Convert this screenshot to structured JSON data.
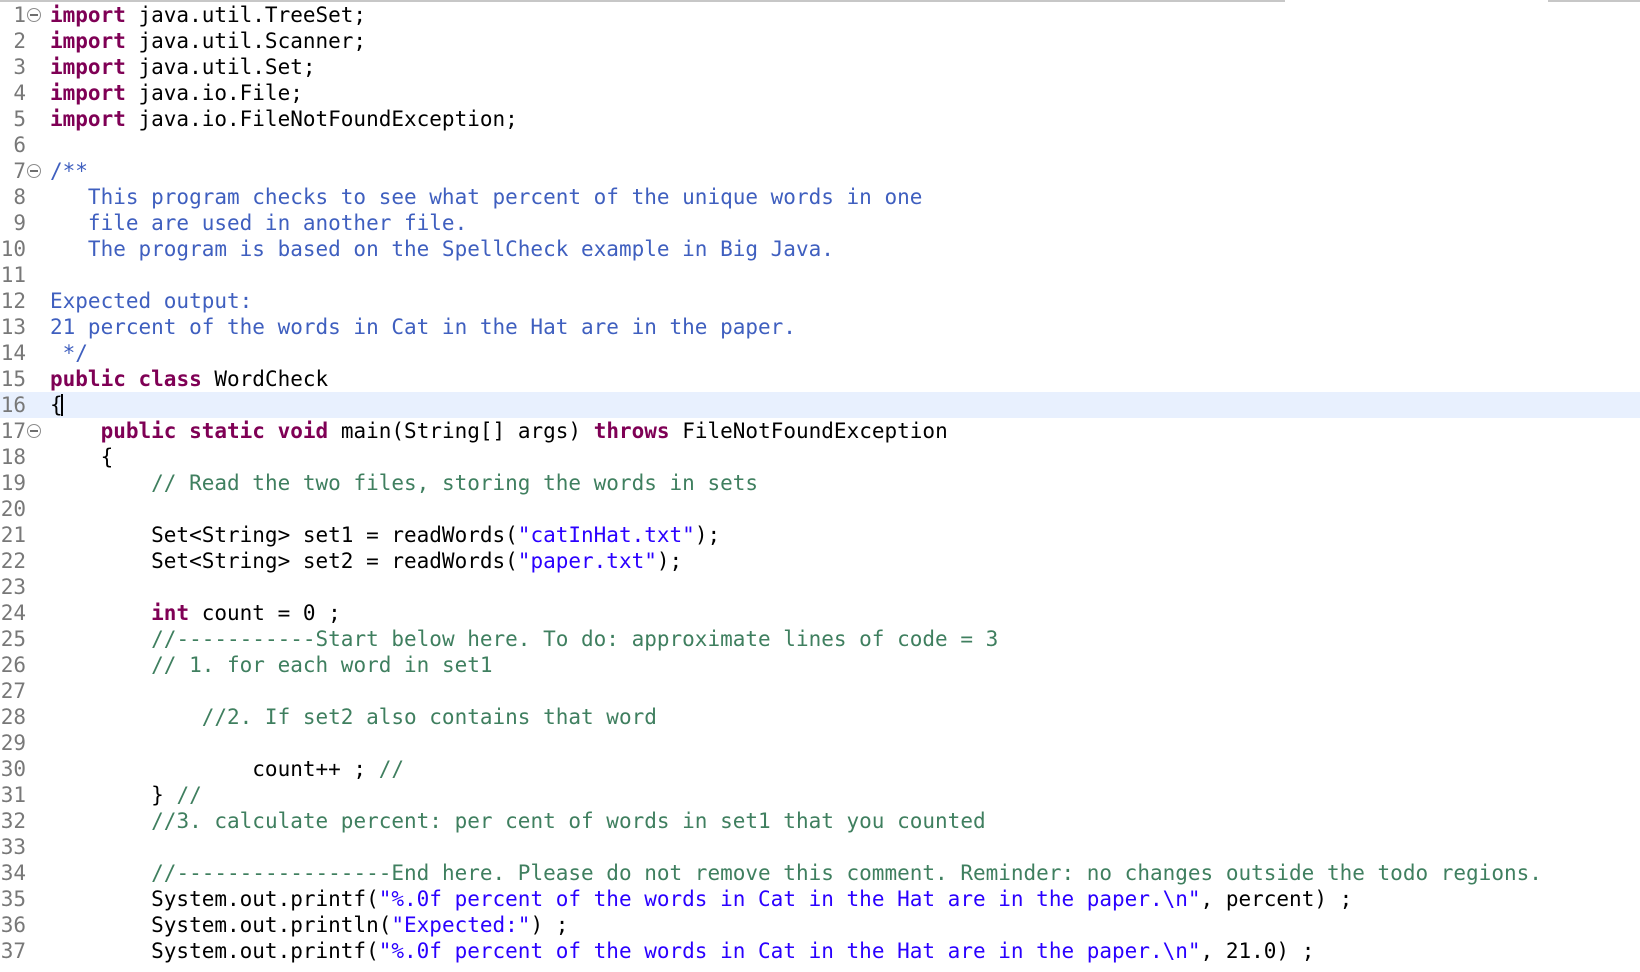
{
  "editor": {
    "language": "java",
    "current_line": 16,
    "colors": {
      "keyword": "#7f0055",
      "javadoc": "#3f5fbf",
      "comment": "#3f7f5f",
      "string": "#2a00ff",
      "plain": "#000000",
      "line_number": "#787878",
      "current_line_bg": "#e8f0fe"
    },
    "lines": [
      {
        "n": "1",
        "fold": true,
        "tokens": [
          {
            "t": "kw",
            "v": "import"
          },
          {
            "t": "pl",
            "v": " java.util.TreeSet;"
          }
        ]
      },
      {
        "n": "2",
        "tokens": [
          {
            "t": "kw",
            "v": "import"
          },
          {
            "t": "pl",
            "v": " java.util.Scanner;"
          }
        ]
      },
      {
        "n": "3",
        "tokens": [
          {
            "t": "kw",
            "v": "import"
          },
          {
            "t": "pl",
            "v": " java.util.Set;"
          }
        ]
      },
      {
        "n": "4",
        "tokens": [
          {
            "t": "kw",
            "v": "import"
          },
          {
            "t": "pl",
            "v": " java.io.File;"
          }
        ]
      },
      {
        "n": "5",
        "tokens": [
          {
            "t": "kw",
            "v": "import"
          },
          {
            "t": "pl",
            "v": " java.io.FileNotFoundException;"
          }
        ]
      },
      {
        "n": "6",
        "tokens": []
      },
      {
        "n": "7",
        "fold": true,
        "tokens": [
          {
            "t": "jd",
            "v": "/**"
          }
        ]
      },
      {
        "n": "8",
        "tokens": [
          {
            "t": "jd",
            "v": "   This program checks to see what percent of the unique words in one"
          }
        ]
      },
      {
        "n": "9",
        "tokens": [
          {
            "t": "jd",
            "v": "   file are used in another file."
          }
        ]
      },
      {
        "n": "10",
        "tokens": [
          {
            "t": "jd",
            "v": "   The program is based on the SpellCheck example in Big Java."
          }
        ]
      },
      {
        "n": "11",
        "tokens": []
      },
      {
        "n": "12",
        "tokens": [
          {
            "t": "jd",
            "v": "Expected output:"
          }
        ]
      },
      {
        "n": "13",
        "tokens": [
          {
            "t": "jd",
            "v": "21 percent of the words in Cat in the Hat are in the paper."
          }
        ]
      },
      {
        "n": "14",
        "tokens": [
          {
            "t": "jd",
            "v": " */"
          }
        ]
      },
      {
        "n": "15",
        "tokens": [
          {
            "t": "kw",
            "v": "public"
          },
          {
            "t": "pl",
            "v": " "
          },
          {
            "t": "kw",
            "v": "class"
          },
          {
            "t": "pl",
            "v": " WordCheck"
          }
        ]
      },
      {
        "n": "16",
        "caret": true,
        "tokens": [
          {
            "t": "pl",
            "v": "{"
          }
        ]
      },
      {
        "n": "17",
        "fold": true,
        "tokens": [
          {
            "t": "pl",
            "v": "    "
          },
          {
            "t": "kw",
            "v": "public"
          },
          {
            "t": "pl",
            "v": " "
          },
          {
            "t": "kw",
            "v": "static"
          },
          {
            "t": "pl",
            "v": " "
          },
          {
            "t": "kw",
            "v": "void"
          },
          {
            "t": "pl",
            "v": " main(String[] args) "
          },
          {
            "t": "kw",
            "v": "throws"
          },
          {
            "t": "pl",
            "v": " FileNotFoundException"
          }
        ]
      },
      {
        "n": "18",
        "tokens": [
          {
            "t": "pl",
            "v": "    {"
          }
        ]
      },
      {
        "n": "19",
        "tokens": [
          {
            "t": "pl",
            "v": "        "
          },
          {
            "t": "cm",
            "v": "// Read the two files, storing the words in sets"
          }
        ]
      },
      {
        "n": "20",
        "tokens": []
      },
      {
        "n": "21",
        "tokens": [
          {
            "t": "pl",
            "v": "        Set<String> set1 = readWords("
          },
          {
            "t": "st",
            "v": "\"catInHat.txt\""
          },
          {
            "t": "pl",
            "v": ");"
          }
        ]
      },
      {
        "n": "22",
        "tokens": [
          {
            "t": "pl",
            "v": "        Set<String> set2 = readWords("
          },
          {
            "t": "st",
            "v": "\"paper.txt\""
          },
          {
            "t": "pl",
            "v": ");"
          }
        ]
      },
      {
        "n": "23",
        "tokens": []
      },
      {
        "n": "24",
        "tokens": [
          {
            "t": "pl",
            "v": "        "
          },
          {
            "t": "kw",
            "v": "int"
          },
          {
            "t": "pl",
            "v": " count = 0 ;"
          }
        ]
      },
      {
        "n": "25",
        "tokens": [
          {
            "t": "pl",
            "v": "        "
          },
          {
            "t": "cm",
            "v": "//-----------Start below here. To do: approximate lines of code = 3"
          }
        ]
      },
      {
        "n": "26",
        "tokens": [
          {
            "t": "pl",
            "v": "        "
          },
          {
            "t": "cm",
            "v": "// 1. for each word in set1"
          }
        ]
      },
      {
        "n": "27",
        "tokens": []
      },
      {
        "n": "28",
        "tokens": [
          {
            "t": "pl",
            "v": "            "
          },
          {
            "t": "cm",
            "v": "//2. If set2 also contains that word"
          }
        ]
      },
      {
        "n": "29",
        "tokens": []
      },
      {
        "n": "30",
        "tokens": [
          {
            "t": "pl",
            "v": "                count++ ; "
          },
          {
            "t": "cm",
            "v": "//"
          }
        ]
      },
      {
        "n": "31",
        "tokens": [
          {
            "t": "pl",
            "v": "        } "
          },
          {
            "t": "cm",
            "v": "//"
          }
        ]
      },
      {
        "n": "32",
        "tokens": [
          {
            "t": "pl",
            "v": "        "
          },
          {
            "t": "cm",
            "v": "//3. calculate percent: per cent of words in set1 that you counted"
          }
        ]
      },
      {
        "n": "33",
        "tokens": []
      },
      {
        "n": "34",
        "tokens": [
          {
            "t": "pl",
            "v": "        "
          },
          {
            "t": "cm",
            "v": "//-----------------End here. Please do not remove this comment. Reminder: no changes outside the todo regions."
          }
        ]
      },
      {
        "n": "35",
        "tokens": [
          {
            "t": "pl",
            "v": "        System.out.printf("
          },
          {
            "t": "st",
            "v": "\"%.0f percent of the words in Cat in the Hat are in the paper.\\n\""
          },
          {
            "t": "pl",
            "v": ", percent) ;"
          }
        ]
      },
      {
        "n": "36",
        "tokens": [
          {
            "t": "pl",
            "v": "        System.out.println("
          },
          {
            "t": "st",
            "v": "\"Expected:\""
          },
          {
            "t": "pl",
            "v": ") ;"
          }
        ]
      },
      {
        "n": "37",
        "tokens": [
          {
            "t": "pl",
            "v": "        System.out.printf("
          },
          {
            "t": "st",
            "v": "\"%.0f percent of the words in Cat in the Hat are in the paper.\\n\""
          },
          {
            "t": "pl",
            "v": ", 21.0) ;"
          }
        ]
      }
    ]
  }
}
